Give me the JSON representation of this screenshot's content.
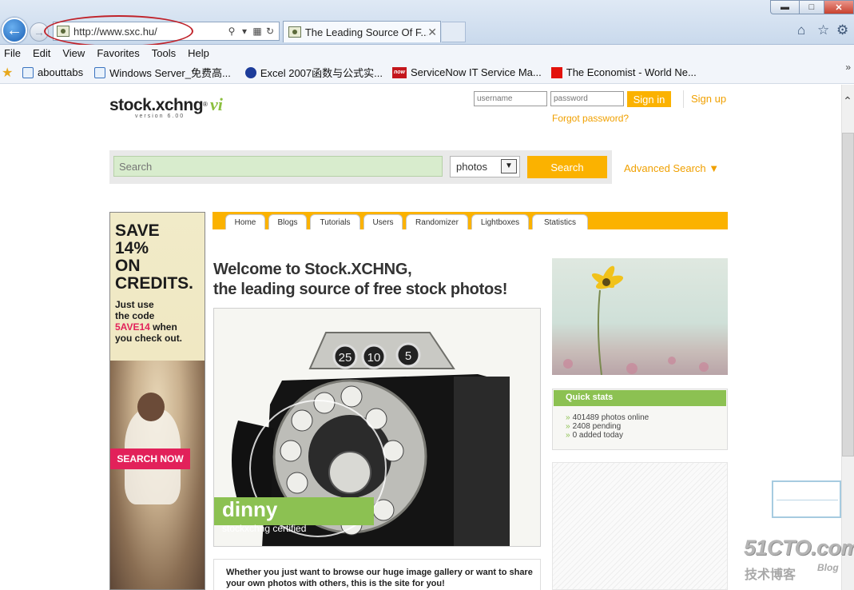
{
  "browser": {
    "address_url": "http://www.sxc.hu/",
    "tab_title": "The Leading Source Of F...",
    "menu": [
      "File",
      "Edit",
      "View",
      "Favorites",
      "Tools",
      "Help"
    ],
    "favorites": [
      {
        "label": "abouttabs",
        "icon": "ie-page-icon"
      },
      {
        "label": "Windows Server_免费高...",
        "icon": "ie-page-icon"
      },
      {
        "label": "Excel 2007函数与公式实...",
        "icon": "paw-icon"
      },
      {
        "label": "ServiceNow IT Service Ma...",
        "icon": "servicenow-icon"
      },
      {
        "label": "The Economist - World Ne...",
        "icon": "economist-icon"
      }
    ],
    "favicon_now_text": "now",
    "highlight_color": "#c0222a"
  },
  "site": {
    "logo": {
      "name": "stock.xchng",
      "reg": "®",
      "vi": "vi",
      "version": "version 6.00"
    },
    "login": {
      "username_placeholder": "username",
      "password_placeholder": "password",
      "signin_label": "Sign in",
      "signup_label": "Sign up",
      "forgot_label": "Forgot password?"
    },
    "search": {
      "placeholder": "Search",
      "type_selected": "photos",
      "button_label": "Search",
      "advanced_label": "Advanced Search"
    },
    "tabs": [
      "Home",
      "Blogs",
      "Tutorials",
      "Users",
      "Randomizer",
      "Lightboxes",
      "Statistics"
    ],
    "welcome_line1": "Welcome to Stock.XCHNG,",
    "welcome_line2": "the leading source of free stock photos!",
    "hero": {
      "photographer": "dinny",
      "certified": "stockxchng certified",
      "dial_numbers": [
        "25",
        "10",
        "5"
      ]
    },
    "intro_text": "Whether you just want to browse our huge image gallery or want to share your own photos with others, this is the site for you!",
    "quick_stats": {
      "title": "Quick stats",
      "lines": [
        "401489 photos online",
        "2408 pending",
        "0 added today"
      ]
    },
    "accent_color": "#fbb200",
    "green_color": "#8cc152"
  },
  "ad": {
    "headline": [
      "SAVE",
      "14%",
      "ON",
      "CREDITS."
    ],
    "copy_line1": "Just use",
    "copy_line2": "the code",
    "code": "5AVE14",
    "copy_line3": " when",
    "copy_line4": "you check out.",
    "cta": "SEARCH NOW",
    "accent_color": "#e2215a"
  },
  "watermark": {
    "main": "51CTO.com",
    "sub": "技术博客",
    "blog": "Blog"
  }
}
